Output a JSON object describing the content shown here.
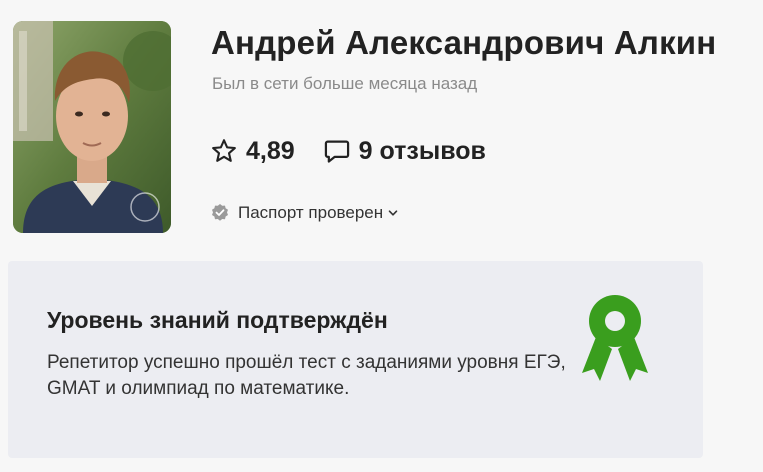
{
  "profile": {
    "name": "Андрей Александрович Алкин",
    "last_seen": "Был в сети больше месяца назад",
    "avatar_icon": "tutor-photo"
  },
  "stats": {
    "rating": "4,89",
    "rating_icon": "star-icon",
    "reviews": "9 отзывов",
    "reviews_icon": "comment-icon"
  },
  "verification": {
    "passport_label": "Паспорт проверен",
    "icon": "verified-badge-icon",
    "dropdown_icon": "chevron-down-icon"
  },
  "knowledge_card": {
    "title": "Уровень знаний подтверждён",
    "description": "Репетитор успешно прошёл тест с заданиями уровня ЕГЭ, GMAT и олимпиад по математике.",
    "icon": "award-ribbon-icon"
  },
  "colors": {
    "award_green": "#3a9e1e",
    "card_background": "#ecedf2",
    "muted_text": "#8a8a8a"
  }
}
